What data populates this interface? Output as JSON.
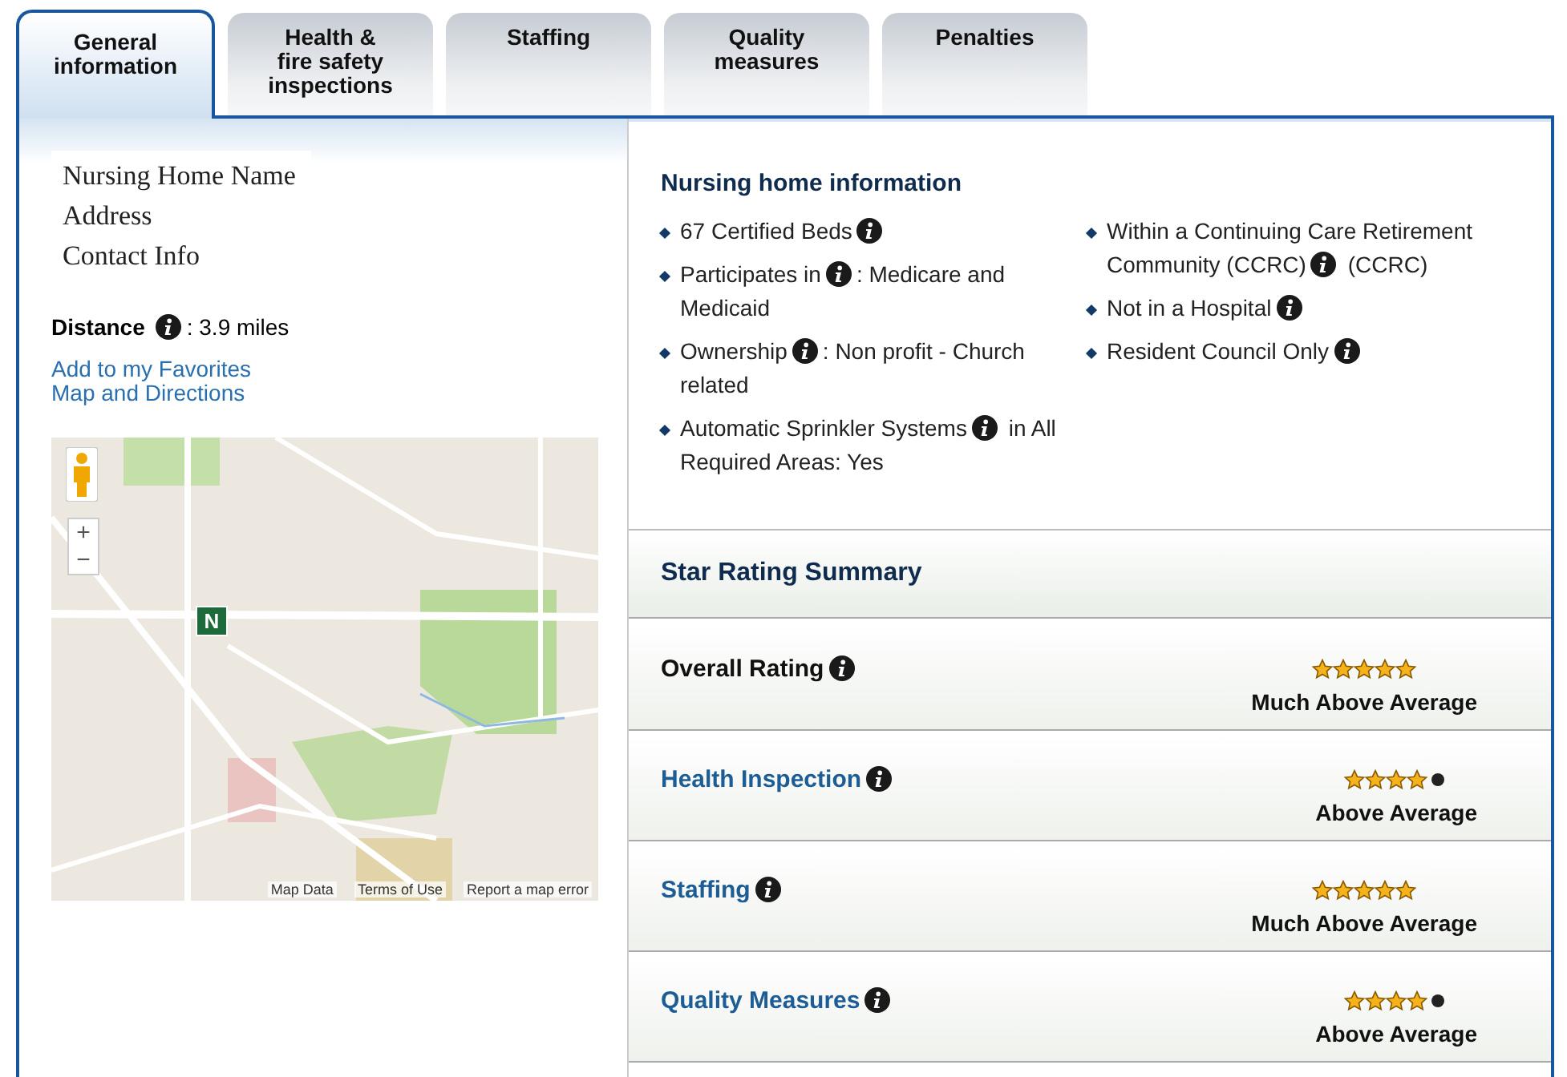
{
  "tabs": [
    {
      "label": "General\ninformation",
      "selected": true
    },
    {
      "label": "Health &\nfire safety\ninspections",
      "selected": false
    },
    {
      "label": "Staffing",
      "selected": false
    },
    {
      "label": "Quality\nmeasures",
      "selected": false
    },
    {
      "label": "Penalties",
      "selected": false
    }
  ],
  "facility": {
    "lines": [
      "Nursing Home Name",
      "Address",
      "Contact Info"
    ],
    "distance_label": "Distance",
    "distance_value": ": 3.9 miles",
    "links": [
      "Add to my Favorites",
      "Map and Directions"
    ]
  },
  "map": {
    "zoom_in": "+",
    "zoom_out": "−",
    "marker": "N",
    "footer_links": [
      "Map Data",
      "Terms of Use",
      "Report a map error"
    ]
  },
  "info": {
    "title": "Nursing home information",
    "columns": [
      [
        {
          "before": "67 Certified Beds"
        },
        {
          "before": "Participates in",
          "after": ": Medicare and Medicaid"
        },
        {
          "before": "Ownership",
          "after": ": Non profit - Church related"
        },
        {
          "before": "Automatic Sprinkler Systems",
          "after": " in All Required Areas: Yes"
        }
      ],
      [
        {
          "before": "Within a Continuing Care Retirement Community (CCRC)",
          "after": " (CCRC)"
        },
        {
          "before": "Not in a Hospital"
        },
        {
          "before": "Resident Council Only"
        }
      ]
    ]
  },
  "star_summary": {
    "title": "Star Rating Summary",
    "rows": [
      {
        "label": "Overall Rating",
        "kind": "overall",
        "stars": 5,
        "rating": "Much Above Average"
      },
      {
        "label": "Health Inspection",
        "kind": "link",
        "stars": 4,
        "rating": "Above Average"
      },
      {
        "label": "Staffing",
        "kind": "link",
        "stars": 5,
        "rating": "Much Above Average"
      },
      {
        "label": "Quality Measures",
        "kind": "link",
        "stars": 4,
        "rating": "Above Average"
      }
    ]
  }
}
